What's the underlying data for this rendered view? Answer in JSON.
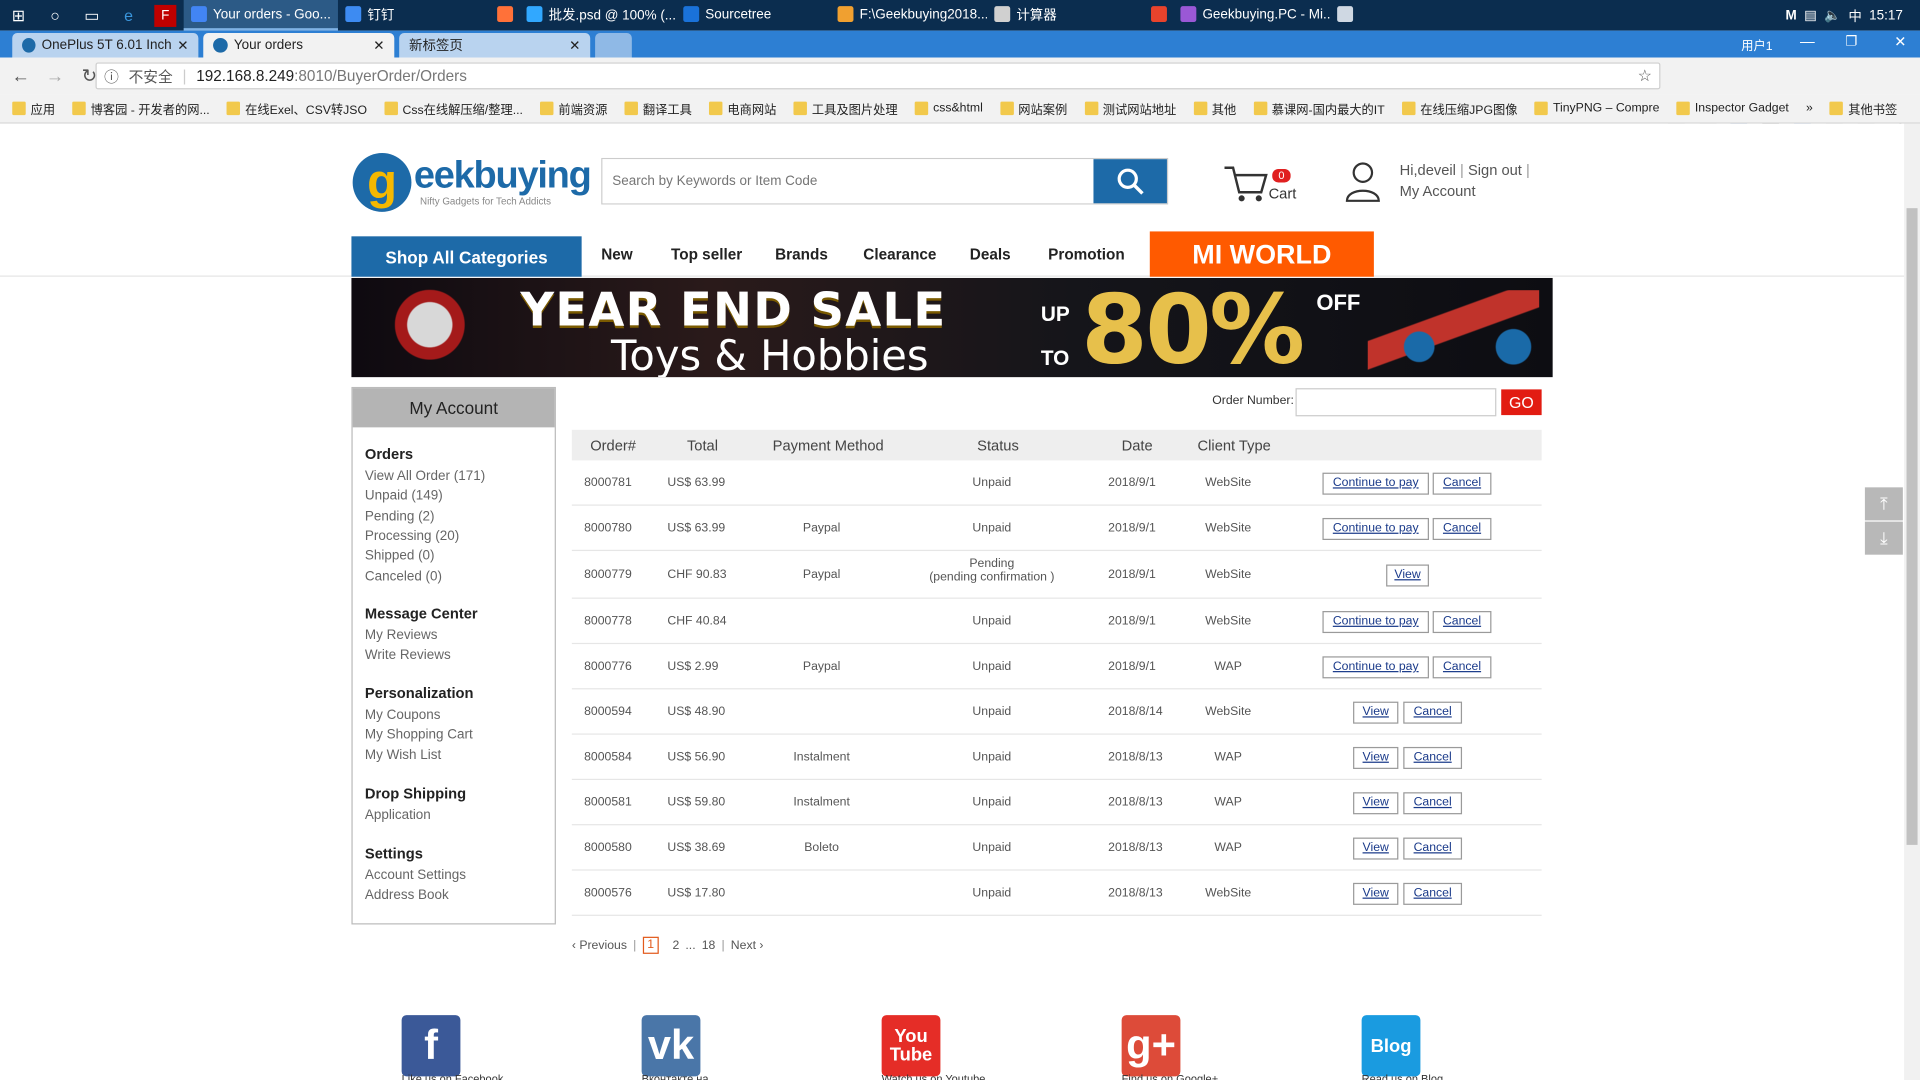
{
  "taskbar": {
    "apps": [
      {
        "label": "Your orders - Goo...",
        "active": true,
        "icon_color": "#4285f4"
      },
      {
        "label": "钉钉",
        "active": false,
        "icon_color": "#3d8bf2"
      },
      {
        "label": "",
        "active": false,
        "icon_color": "#ff7139"
      },
      {
        "label": "批发.psd @ 100% (...",
        "active": false,
        "icon_color": "#31a8ff"
      },
      {
        "label": "Sourcetree",
        "active": false,
        "icon_color": "#1a72d9"
      },
      {
        "label": "F:\\Geekbuying2018...",
        "active": false,
        "icon_color": "#f0a030"
      },
      {
        "label": "计算器",
        "active": false,
        "icon_color": "#d0d0d0"
      },
      {
        "label": "",
        "active": false,
        "icon_color": "#e8432c"
      },
      {
        "label": "Geekbuying.PC - Mi...",
        "active": false,
        "icon_color": "#9a58d6"
      },
      {
        "label": "",
        "active": false,
        "icon_color": "#cfd8e3"
      }
    ],
    "tray": {
      "ime": "中",
      "time": "15:17"
    }
  },
  "browser": {
    "tabs": [
      {
        "label": "OnePlus 5T 6.01 Inch 6",
        "active": false
      },
      {
        "label": "Your orders",
        "active": true
      },
      {
        "label": "新标签页",
        "active": false
      }
    ],
    "user_label": "用户1",
    "security_label": "不安全",
    "url_host": "192.168.8.249",
    "url_path": ":8010/BuyerOrder/Orders",
    "bookmarks": [
      "应用",
      "博客园 - 开发者的网...",
      "在线Exel、CSV转JSO",
      "Css在线解压缩/整理...",
      "前端资源",
      "翻译工具",
      "电商网站",
      "工具及图片处理",
      "css&html",
      "网站案例",
      "测试网站地址",
      "其他",
      "慕课网-国内最大的IT",
      "在线压缩JPG图像",
      "TinyPNG – Compre",
      "Inspector Gadget",
      "»",
      "其他书签"
    ]
  },
  "header": {
    "logo_text": "eekbuying",
    "logo_letter": "g",
    "logo_tagline": "Nifty Gadgets for Tech Addicts",
    "search_placeholder": "Search by Keywords or Item Code",
    "cart_count": "0",
    "cart_label": "Cart",
    "greeting": "Hi,deveil",
    "sign_out": "Sign out",
    "my_account": "My Account"
  },
  "nav": {
    "shop_all": "Shop All Categories",
    "items": [
      "New",
      "Top seller",
      "Brands",
      "Clearance",
      "Deals",
      "Promotion"
    ],
    "mi_world": "MI WORLD"
  },
  "banner": {
    "line1": "YEAR END SALE",
    "line2": "Toys & Hobbies",
    "up": "UP",
    "to": "TO",
    "percent": "80%",
    "off": "OFF"
  },
  "sidebar": {
    "title": "My Account",
    "sections": [
      {
        "title": "Orders",
        "links": [
          "View All Order (171)",
          "Unpaid (149)",
          "Pending (2)",
          "Processing (20)",
          "Shipped (0)",
          "Canceled (0)"
        ]
      },
      {
        "title": "Message Center",
        "links": [
          "My Reviews",
          "Write Reviews"
        ]
      },
      {
        "title": "Personalization",
        "links": [
          "My Coupons",
          "My Shopping Cart",
          "My Wish List"
        ]
      },
      {
        "title": "Drop Shipping",
        "links": [
          "Application"
        ]
      },
      {
        "title": "Settings",
        "links": [
          "Account Settings",
          "Address Book"
        ]
      }
    ]
  },
  "orders": {
    "order_number_label": "Order Number:",
    "order_number_value": "",
    "go_label": "GO",
    "columns": [
      "Order#",
      "Total",
      "Payment Method",
      "Status",
      "Date",
      "Client Type"
    ],
    "rows": [
      {
        "order": "8000781",
        "total": "US$ 63.99",
        "payment": "",
        "status": "Unpaid",
        "status2": "",
        "date": "2018/9/1",
        "client": "WebSite",
        "actions": [
          "Continue to pay",
          "Cancel"
        ]
      },
      {
        "order": "8000780",
        "total": "US$ 63.99",
        "payment": "Paypal",
        "status": "Unpaid",
        "status2": "",
        "date": "2018/9/1",
        "client": "WebSite",
        "actions": [
          "Continue to pay",
          "Cancel"
        ]
      },
      {
        "order": "8000779",
        "total": "CHF 90.83",
        "payment": "Paypal",
        "status": "Pending",
        "status2": "(pending confirmation )",
        "date": "2018/9/1",
        "client": "WebSite",
        "actions": [
          "View"
        ]
      },
      {
        "order": "8000778",
        "total": "CHF 40.84",
        "payment": "",
        "status": "Unpaid",
        "status2": "",
        "date": "2018/9/1",
        "client": "WebSite",
        "actions": [
          "Continue to pay",
          "Cancel"
        ]
      },
      {
        "order": "8000776",
        "total": "US$ 2.99",
        "payment": "Paypal",
        "status": "Unpaid",
        "status2": "",
        "date": "2018/9/1",
        "client": "WAP",
        "actions": [
          "Continue to pay",
          "Cancel"
        ]
      },
      {
        "order": "8000594",
        "total": "US$ 48.90",
        "payment": "",
        "status": "Unpaid",
        "status2": "",
        "date": "2018/8/14",
        "client": "WebSite",
        "actions": [
          "View",
          "Cancel"
        ]
      },
      {
        "order": "8000584",
        "total": "US$ 56.90",
        "payment": "Instalment",
        "status": "Unpaid",
        "status2": "",
        "date": "2018/8/13",
        "client": "WAP",
        "actions": [
          "View",
          "Cancel"
        ]
      },
      {
        "order": "8000581",
        "total": "US$ 59.80",
        "payment": "Instalment",
        "status": "Unpaid",
        "status2": "",
        "date": "2018/8/13",
        "client": "WAP",
        "actions": [
          "View",
          "Cancel"
        ]
      },
      {
        "order": "8000580",
        "total": "US$ 38.69",
        "payment": "Boleto",
        "status": "Unpaid",
        "status2": "",
        "date": "2018/8/13",
        "client": "WAP",
        "actions": [
          "View",
          "Cancel"
        ]
      },
      {
        "order": "8000576",
        "total": "US$ 17.80",
        "payment": "",
        "status": "Unpaid",
        "status2": "",
        "date": "2018/8/13",
        "client": "WebSite",
        "actions": [
          "View",
          "Cancel"
        ]
      }
    ]
  },
  "pagination": {
    "previous": "‹ Previous",
    "pages": [
      "1",
      "2",
      "...",
      "18"
    ],
    "current": "1",
    "next": "Next ›"
  },
  "social": [
    {
      "name": "facebook",
      "glyph": "f",
      "caption": "Like us on Facebook",
      "color": "#3b5998"
    },
    {
      "name": "vk",
      "glyph": "vk",
      "caption": "Вконтакте на",
      "color": "#4a76a8"
    },
    {
      "name": "youtube",
      "glyph": "You Tube",
      "caption": "Watch us on Youtube",
      "color": "#e52d27"
    },
    {
      "name": "google-plus",
      "glyph": "g+",
      "caption": "Find us on Google+",
      "color": "#dd4b39"
    },
    {
      "name": "blog",
      "glyph": "Blog",
      "caption": "Read us on Blog",
      "color": "#1a9be0"
    }
  ],
  "float_buttons": [
    "back-to-top",
    "go-to-bottom"
  ]
}
